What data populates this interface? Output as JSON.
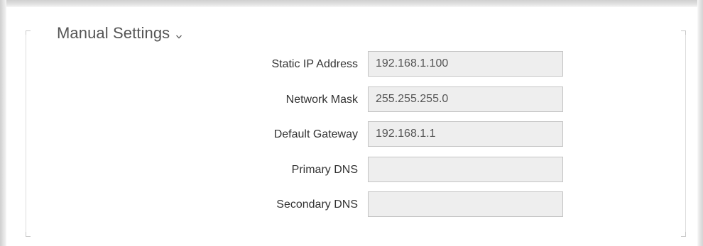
{
  "section": {
    "title": "Manual Settings",
    "chevron_icon": "chevron-down-icon"
  },
  "fields": [
    {
      "label": "Static IP Address",
      "value": "192.168.1.100"
    },
    {
      "label": "Network Mask",
      "value": "255.255.255.0"
    },
    {
      "label": "Default Gateway",
      "value": "192.168.1.1"
    },
    {
      "label": "Primary DNS",
      "value": ""
    },
    {
      "label": "Secondary DNS",
      "value": ""
    }
  ],
  "colors": {
    "field_background": "#eeeeee",
    "field_border": "#c4c4c4",
    "label_text": "#333333",
    "title_text": "#555555"
  }
}
